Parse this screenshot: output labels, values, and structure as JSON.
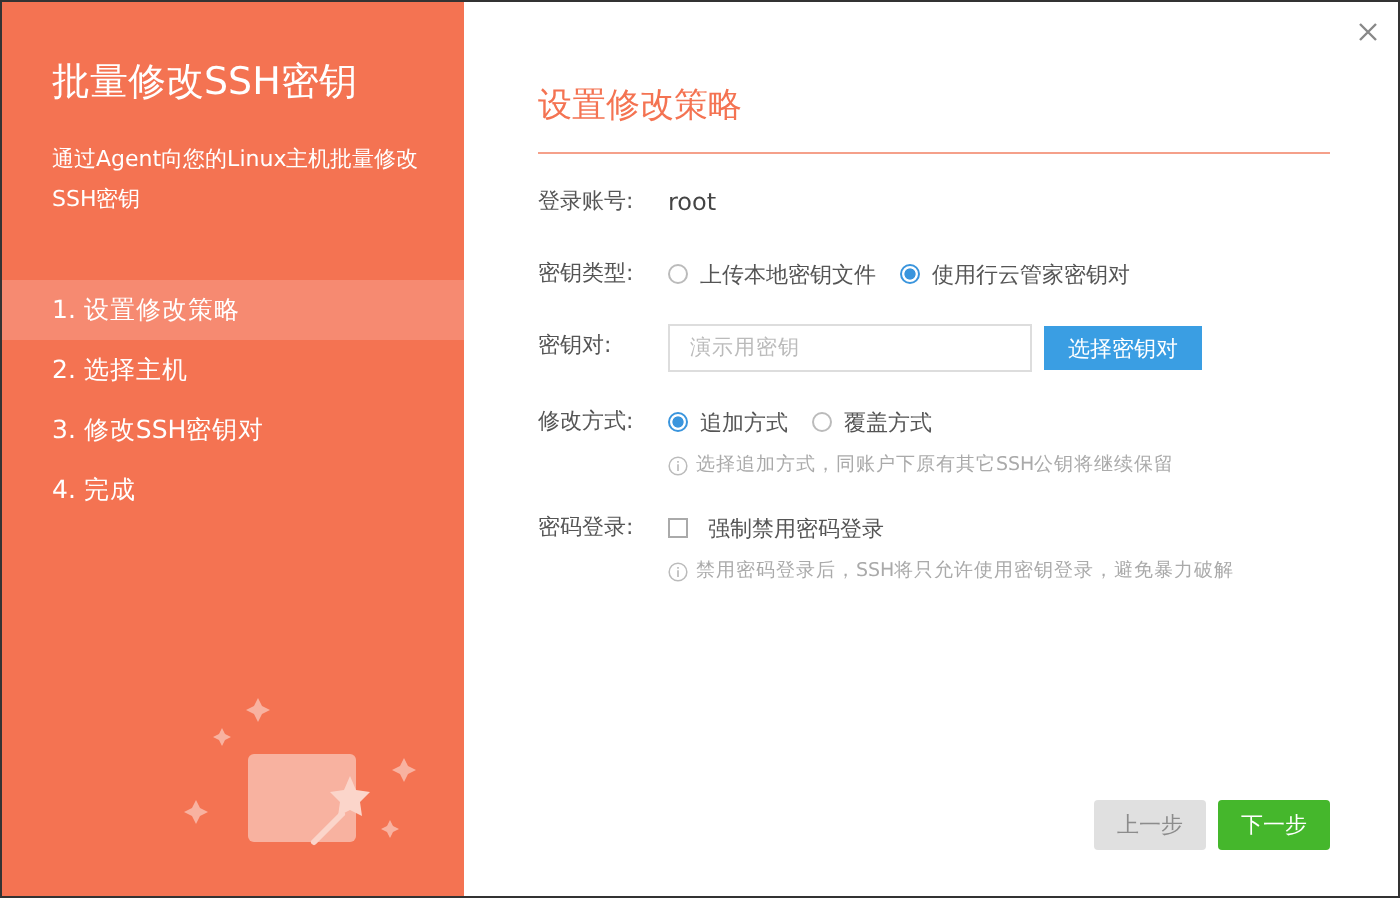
{
  "sidebar": {
    "title": "批量修改SSH密钥",
    "description": "通过Agent向您的Linux主机批量修改SSH密钥",
    "steps": [
      {
        "label": "1. 设置修改策略",
        "selected": true
      },
      {
        "label": "2. 选择主机",
        "selected": false
      },
      {
        "label": "3. 修改SSH密钥对",
        "selected": false
      },
      {
        "label": "4. 完成",
        "selected": false
      }
    ]
  },
  "form": {
    "heading": "设置修改策略",
    "rows": [
      {
        "kind": "text",
        "label": "登录账号:",
        "value": "root"
      },
      {
        "kind": "radio",
        "label": "密钥类型:",
        "options": [
          {
            "label": "上传本地密钥文件",
            "selected": false
          },
          {
            "label": "使用行云管家密钥对",
            "selected": true
          }
        ]
      },
      {
        "kind": "input",
        "label": "密钥对:",
        "placeholder": "演示用密钥",
        "button": "选择密钥对"
      },
      {
        "kind": "radio",
        "label": "修改方式:",
        "options": [
          {
            "label": "追加方式",
            "selected": true
          },
          {
            "label": "覆盖方式",
            "selected": false
          }
        ],
        "hint": "选择追加方式，同账户下原有其它SSH公钥将继续保留"
      },
      {
        "kind": "checkbox",
        "label": "密码登录:",
        "option": "强制禁用密码登录",
        "checked": false,
        "hint": "禁用密码登录后，SSH将只允许使用密钥登录，避免暴力破解"
      }
    ]
  },
  "buttons": [
    {
      "label": "上一步",
      "kind": "secondary",
      "disabled": true
    },
    {
      "label": "下一步",
      "kind": "primary",
      "disabled": false
    }
  ]
}
